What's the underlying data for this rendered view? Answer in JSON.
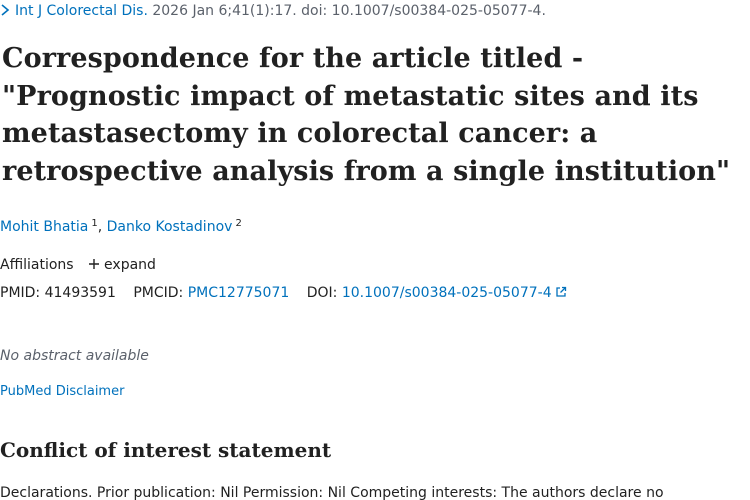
{
  "citation": {
    "journal": "Int J Colorectal Dis.",
    "details": "2026 Jan 6;41(1):17. doi: 10.1007/s00384-025-05077-4."
  },
  "article": {
    "title": "Correspondence for the article titled - \"Prognostic impact of metastatic sites and its metastasectomy in colorectal cancer: a retrospective analysis from a single institution\""
  },
  "authors": [
    {
      "name": "Mohit Bhatia",
      "affiliation_ref": "1"
    },
    {
      "name": "Danko Kostadinov",
      "affiliation_ref": "2"
    }
  ],
  "author_separator": ",",
  "affiliations": {
    "label": "Affiliations",
    "expand_label": "expand"
  },
  "identifiers": {
    "pmid_label": "PMID:",
    "pmid": "41493591",
    "pmcid_label": "PMCID:",
    "pmcid": "PMC12775071",
    "doi_label": "DOI:",
    "doi": "10.1007/s00384-025-05077-4"
  },
  "abstract": {
    "status": "No abstract available"
  },
  "disclaimer": {
    "label": "PubMed Disclaimer"
  },
  "conflict_of_interest": {
    "heading": "Conflict of interest statement",
    "text": "Declarations. Prior publication: Nil Permission: Nil Competing interests: The authors declare no"
  },
  "icons": {
    "citation_chevron": "chevron-right-icon",
    "expand": "plus-icon",
    "doi_external": "external-link-icon"
  },
  "colors": {
    "link": "#0071bc",
    "text": "#212121",
    "muted": "#5b616b"
  }
}
